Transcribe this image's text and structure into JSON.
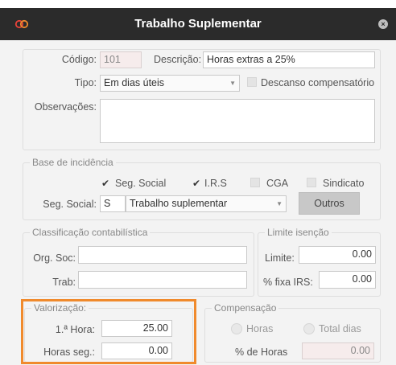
{
  "window": {
    "title": "Trabalho Suplementar",
    "close_glyph": "×",
    "accent": "#f08a2c"
  },
  "form": {
    "codigo_label": "Código:",
    "codigo_value": "101",
    "descricao_label": "Descrição:",
    "descricao_value": "Horas extras a 25%",
    "tipo_label": "Tipo:",
    "tipo_value": "Em dias úteis",
    "descanso_label": "Descanso compensatório",
    "observacoes_label": "Observações:"
  },
  "base_incidencia": {
    "legend": "Base de incidência",
    "checks": [
      {
        "label": "Seg. Social",
        "checked": true
      },
      {
        "label": "I.R.S",
        "checked": true
      },
      {
        "label": "CGA",
        "checked": false
      },
      {
        "label": "Sindicato",
        "checked": false
      }
    ],
    "seg_social_label": "Seg. Social:",
    "seg_social_code": "S",
    "seg_social_value": "Trabalho suplementar",
    "outros_button": "Outros"
  },
  "classificacao": {
    "legend": "Classificação contabilística",
    "org_soc_label": "Org. Soc:",
    "trab_label": "Trab:"
  },
  "limite": {
    "legend": "Limite isenção",
    "limite_label": "Limite:",
    "limite_value": "0.00",
    "fixa_label": "% fixa IRS:",
    "fixa_value": "0.00"
  },
  "valorizacao": {
    "legend": "Valorização:",
    "hora1_label": "1.ª Hora:",
    "hora1_value": "25.00",
    "horas_seg_label": "Horas seg.:",
    "horas_seg_value": "0.00"
  },
  "compensacao": {
    "legend": "Compensação",
    "horas_radio": "Horas",
    "total_dias_radio": "Total dias",
    "pct_horas_label": "% de Horas",
    "pct_horas_value": "0.00"
  }
}
